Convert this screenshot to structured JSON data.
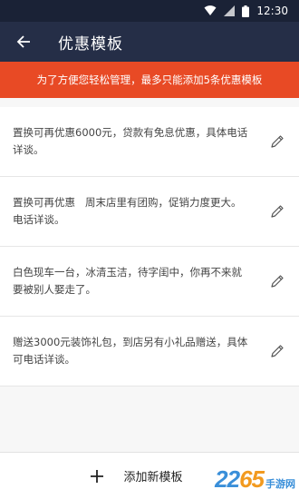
{
  "status_bar": {
    "time": "12:30",
    "icons": [
      "wifi-icon",
      "signal-icon",
      "battery-icon"
    ]
  },
  "app_bar": {
    "title": "优惠模板",
    "back_icon": "arrow-back-icon"
  },
  "notice": {
    "text": "为了方便您轻松管理，最多只能添加5条优惠模板"
  },
  "templates": [
    {
      "text": "置换可再优惠6000元，贷款有免息优惠，具体电话详谈。"
    },
    {
      "text": "置换可再优惠   周末店里有团购，促销力度更大。电话详谈。"
    },
    {
      "text": "白色现车一台，冰清玉洁，待字闺中，你再不来就要被别人娶走了。"
    },
    {
      "text": "赠送3000元装饰礼包，到店另有小礼品赠送，具体可电话详谈。"
    }
  ],
  "footer": {
    "add_label": "添加新模板",
    "add_icon": "plus-icon"
  },
  "watermark": {
    "number_a": "22",
    "number_b": "65",
    "suffix": "手游网"
  },
  "colors": {
    "status_bar": "#1a2236",
    "app_bar": "#252e47",
    "notice": "#e84a25",
    "background": "#f7f7f7"
  }
}
